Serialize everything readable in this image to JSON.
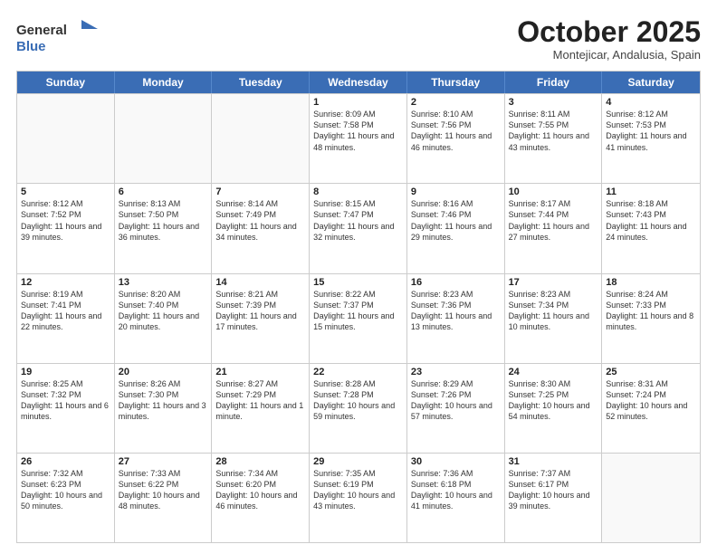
{
  "logo": {
    "line1": "General",
    "line2": "Blue"
  },
  "title": "October 2025",
  "subtitle": "Montejicar, Andalusia, Spain",
  "days": [
    "Sunday",
    "Monday",
    "Tuesday",
    "Wednesday",
    "Thursday",
    "Friday",
    "Saturday"
  ],
  "weeks": [
    [
      {
        "day": "",
        "text": ""
      },
      {
        "day": "",
        "text": ""
      },
      {
        "day": "",
        "text": ""
      },
      {
        "day": "1",
        "text": "Sunrise: 8:09 AM\nSunset: 7:58 PM\nDaylight: 11 hours and 48 minutes."
      },
      {
        "day": "2",
        "text": "Sunrise: 8:10 AM\nSunset: 7:56 PM\nDaylight: 11 hours and 46 minutes."
      },
      {
        "day": "3",
        "text": "Sunrise: 8:11 AM\nSunset: 7:55 PM\nDaylight: 11 hours and 43 minutes."
      },
      {
        "day": "4",
        "text": "Sunrise: 8:12 AM\nSunset: 7:53 PM\nDaylight: 11 hours and 41 minutes."
      }
    ],
    [
      {
        "day": "5",
        "text": "Sunrise: 8:12 AM\nSunset: 7:52 PM\nDaylight: 11 hours and 39 minutes."
      },
      {
        "day": "6",
        "text": "Sunrise: 8:13 AM\nSunset: 7:50 PM\nDaylight: 11 hours and 36 minutes."
      },
      {
        "day": "7",
        "text": "Sunrise: 8:14 AM\nSunset: 7:49 PM\nDaylight: 11 hours and 34 minutes."
      },
      {
        "day": "8",
        "text": "Sunrise: 8:15 AM\nSunset: 7:47 PM\nDaylight: 11 hours and 32 minutes."
      },
      {
        "day": "9",
        "text": "Sunrise: 8:16 AM\nSunset: 7:46 PM\nDaylight: 11 hours and 29 minutes."
      },
      {
        "day": "10",
        "text": "Sunrise: 8:17 AM\nSunset: 7:44 PM\nDaylight: 11 hours and 27 minutes."
      },
      {
        "day": "11",
        "text": "Sunrise: 8:18 AM\nSunset: 7:43 PM\nDaylight: 11 hours and 24 minutes."
      }
    ],
    [
      {
        "day": "12",
        "text": "Sunrise: 8:19 AM\nSunset: 7:41 PM\nDaylight: 11 hours and 22 minutes."
      },
      {
        "day": "13",
        "text": "Sunrise: 8:20 AM\nSunset: 7:40 PM\nDaylight: 11 hours and 20 minutes."
      },
      {
        "day": "14",
        "text": "Sunrise: 8:21 AM\nSunset: 7:39 PM\nDaylight: 11 hours and 17 minutes."
      },
      {
        "day": "15",
        "text": "Sunrise: 8:22 AM\nSunset: 7:37 PM\nDaylight: 11 hours and 15 minutes."
      },
      {
        "day": "16",
        "text": "Sunrise: 8:23 AM\nSunset: 7:36 PM\nDaylight: 11 hours and 13 minutes."
      },
      {
        "day": "17",
        "text": "Sunrise: 8:23 AM\nSunset: 7:34 PM\nDaylight: 11 hours and 10 minutes."
      },
      {
        "day": "18",
        "text": "Sunrise: 8:24 AM\nSunset: 7:33 PM\nDaylight: 11 hours and 8 minutes."
      }
    ],
    [
      {
        "day": "19",
        "text": "Sunrise: 8:25 AM\nSunset: 7:32 PM\nDaylight: 11 hours and 6 minutes."
      },
      {
        "day": "20",
        "text": "Sunrise: 8:26 AM\nSunset: 7:30 PM\nDaylight: 11 hours and 3 minutes."
      },
      {
        "day": "21",
        "text": "Sunrise: 8:27 AM\nSunset: 7:29 PM\nDaylight: 11 hours and 1 minute."
      },
      {
        "day": "22",
        "text": "Sunrise: 8:28 AM\nSunset: 7:28 PM\nDaylight: 10 hours and 59 minutes."
      },
      {
        "day": "23",
        "text": "Sunrise: 8:29 AM\nSunset: 7:26 PM\nDaylight: 10 hours and 57 minutes."
      },
      {
        "day": "24",
        "text": "Sunrise: 8:30 AM\nSunset: 7:25 PM\nDaylight: 10 hours and 54 minutes."
      },
      {
        "day": "25",
        "text": "Sunrise: 8:31 AM\nSunset: 7:24 PM\nDaylight: 10 hours and 52 minutes."
      }
    ],
    [
      {
        "day": "26",
        "text": "Sunrise: 7:32 AM\nSunset: 6:23 PM\nDaylight: 10 hours and 50 minutes."
      },
      {
        "day": "27",
        "text": "Sunrise: 7:33 AM\nSunset: 6:22 PM\nDaylight: 10 hours and 48 minutes."
      },
      {
        "day": "28",
        "text": "Sunrise: 7:34 AM\nSunset: 6:20 PM\nDaylight: 10 hours and 46 minutes."
      },
      {
        "day": "29",
        "text": "Sunrise: 7:35 AM\nSunset: 6:19 PM\nDaylight: 10 hours and 43 minutes."
      },
      {
        "day": "30",
        "text": "Sunrise: 7:36 AM\nSunset: 6:18 PM\nDaylight: 10 hours and 41 minutes."
      },
      {
        "day": "31",
        "text": "Sunrise: 7:37 AM\nSunset: 6:17 PM\nDaylight: 10 hours and 39 minutes."
      },
      {
        "day": "",
        "text": ""
      }
    ]
  ]
}
